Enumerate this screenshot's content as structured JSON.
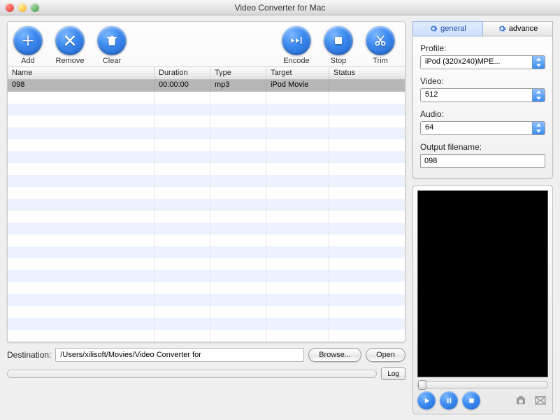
{
  "window": {
    "title": "Video Converter for Mac"
  },
  "toolbar": {
    "add": "Add",
    "remove": "Remove",
    "clear": "Clear",
    "encode": "Encode",
    "stop": "Stop",
    "trim": "Trim"
  },
  "columns": {
    "name": "Name",
    "duration": "Duration",
    "type": "Type",
    "target": "Target",
    "status": "Status"
  },
  "rows": [
    {
      "name": "098",
      "duration": "00:00:00",
      "type": "mp3",
      "target": "iPod Movie",
      "status": ""
    }
  ],
  "destination": {
    "label": "Destination:",
    "path": "/Users/xilisoft/Movies/Video Converter for",
    "browse": "Browse...",
    "open": "Open"
  },
  "log_button": "Log",
  "tabs": {
    "general": "general",
    "advance": "advance"
  },
  "settings": {
    "profile_label": "Profile:",
    "profile_value": "iPod (320x240)MPE...",
    "video_label": "Video:",
    "video_value": "512",
    "audio_label": "Audio:",
    "audio_value": "64",
    "output_label": "Output filename:",
    "output_value": "098"
  }
}
